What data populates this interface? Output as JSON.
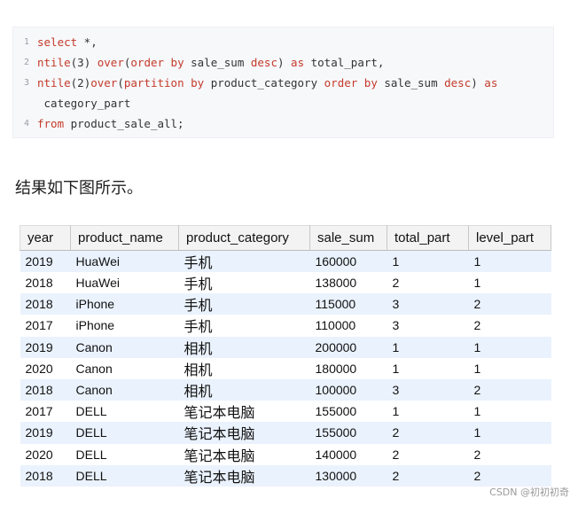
{
  "code": {
    "lines": [
      {
        "num": "1",
        "parts": [
          [
            "kw",
            "select"
          ],
          [
            "t",
            " *,"
          ]
        ]
      },
      {
        "num": "2",
        "parts": [
          [
            "kw",
            "ntile"
          ],
          [
            "t",
            "(3) "
          ],
          [
            "kw",
            "over"
          ],
          [
            "t",
            "("
          ],
          [
            "kw",
            "order by"
          ],
          [
            "t",
            " sale_sum "
          ],
          [
            "kw",
            "desc"
          ],
          [
            "t",
            ") "
          ],
          [
            "kw",
            "as"
          ],
          [
            "t",
            " total_part,"
          ]
        ]
      },
      {
        "num": "3",
        "parts": [
          [
            "kw",
            "ntile"
          ],
          [
            "t",
            "(2)"
          ],
          [
            "kw",
            "over"
          ],
          [
            "t",
            "("
          ],
          [
            "kw",
            "partition by"
          ],
          [
            "t",
            " product_category "
          ],
          [
            "kw",
            "order by"
          ],
          [
            "t",
            " sale_sum "
          ],
          [
            "kw",
            "desc"
          ],
          [
            "t",
            ") "
          ],
          [
            "kw",
            "as"
          ]
        ]
      },
      {
        "num": "",
        "parts": [
          [
            "t",
            " category_part"
          ]
        ]
      },
      {
        "num": "4",
        "parts": [
          [
            "kw",
            "from"
          ],
          [
            "t",
            " product_sale_all;"
          ]
        ]
      }
    ]
  },
  "caption": "结果如下图所示。",
  "table": {
    "headers": [
      "year",
      "product_name",
      "product_category",
      "sale_sum",
      "total_part",
      "level_part"
    ],
    "rows": [
      [
        "2019",
        "HuaWei",
        "手机",
        "160000",
        "1",
        "1"
      ],
      [
        "2018",
        "HuaWei",
        "手机",
        "138000",
        "2",
        "1"
      ],
      [
        "2018",
        "iPhone",
        "手机",
        "115000",
        "3",
        "2"
      ],
      [
        "2017",
        "iPhone",
        "手机",
        "110000",
        "3",
        "2"
      ],
      [
        "2019",
        "Canon",
        "相机",
        "200000",
        "1",
        "1"
      ],
      [
        "2020",
        "Canon",
        "相机",
        "180000",
        "1",
        "1"
      ],
      [
        "2018",
        "Canon",
        "相机",
        "100000",
        "3",
        "2"
      ],
      [
        "2017",
        "DELL",
        "笔记本电脑",
        "155000",
        "1",
        "1"
      ],
      [
        "2019",
        "DELL",
        "笔记本电脑",
        "155000",
        "2",
        "1"
      ],
      [
        "2020",
        "DELL",
        "笔记本电脑",
        "140000",
        "2",
        "2"
      ],
      [
        "2018",
        "DELL",
        "笔记本电脑",
        "130000",
        "2",
        "2"
      ]
    ]
  },
  "watermark": "CSDN @初初初奇",
  "colors": {
    "keyword": "#c43a2a",
    "row_stripe": "#eaf2fd",
    "header_bg": "#f3f3f3"
  }
}
